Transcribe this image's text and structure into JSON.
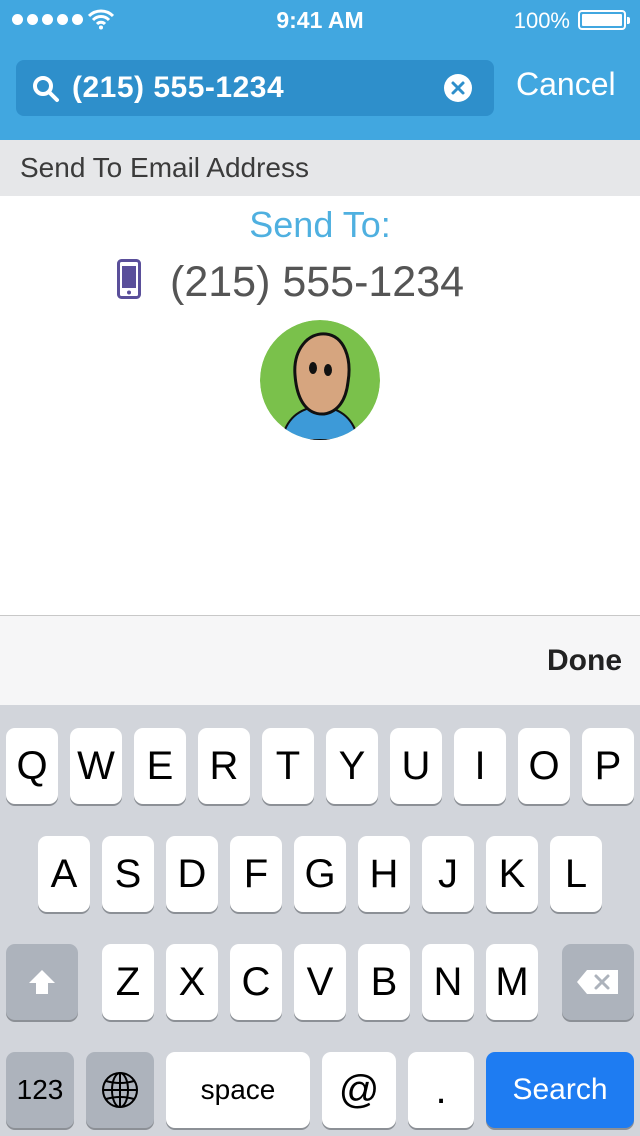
{
  "status_bar": {
    "time": "9:41 AM",
    "battery_percent": "100%"
  },
  "search": {
    "value": "(215) 555-1234",
    "cancel_label": "Cancel"
  },
  "section": {
    "title": "Send To Email Address"
  },
  "content": {
    "send_to_label": "Send To:",
    "phone_number": "(215) 555-1234"
  },
  "accessory": {
    "done_label": "Done"
  },
  "keyboard": {
    "row1": [
      "Q",
      "W",
      "E",
      "R",
      "T",
      "Y",
      "U",
      "I",
      "O",
      "P"
    ],
    "row2": [
      "A",
      "S",
      "D",
      "F",
      "G",
      "H",
      "J",
      "K",
      "L"
    ],
    "row3": [
      "Z",
      "X",
      "C",
      "V",
      "B",
      "N",
      "M"
    ],
    "numbers_label": "123",
    "space_label": "space",
    "at_label": "@",
    "dot_label": ".",
    "search_label": "Search"
  },
  "colors": {
    "header": "#41a7e0",
    "search_field": "#2e8fcb",
    "accent": "#4fb0e0",
    "search_key": "#1e7cf2"
  }
}
